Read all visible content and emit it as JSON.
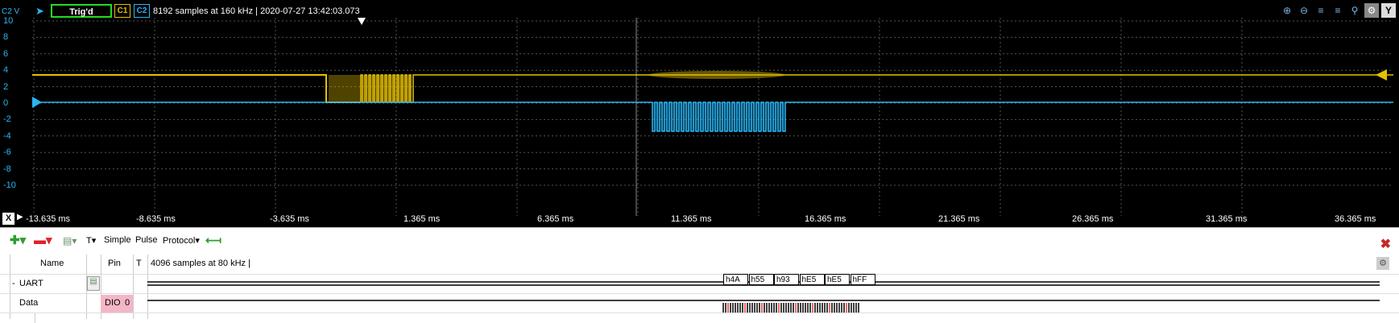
{
  "scope": {
    "channel_label": "C2 V",
    "trigger_status": "Trig'd",
    "c1_label": "C1",
    "c2_label": "C2",
    "info": "8192 samples at 160 kHz | 2020-07-27 13:42:03.073",
    "y_ticks": [
      "10",
      "8",
      "6",
      "4",
      "2",
      "0",
      "-2",
      "-4",
      "-6",
      "-8",
      "-10"
    ],
    "x_axis_button": "X",
    "x_ticks": [
      "-13.635 ms",
      "-8.635 ms",
      "-3.635 ms",
      "1.365 ms",
      "6.365 ms",
      "11.365 ms",
      "16.365 ms",
      "21.365 ms",
      "26.365 ms",
      "31.365 ms",
      "36.365 ms"
    ],
    "colors": {
      "c1": "#e5c100",
      "c2": "#29b6f6",
      "trigger": "#22dd22"
    },
    "tools": [
      "zoom-in-icon",
      "zoom-out-icon",
      "zoom-horizontal-icon",
      "zoom-vertical-icon",
      "magnifier-icon",
      "settings-icon",
      "y-button"
    ],
    "y_button": "Y"
  },
  "logic": {
    "toolbar": {
      "simple": "Simple",
      "pulse": "Pulse",
      "protocol": "Protocol",
      "t_label": "T"
    },
    "columns": {
      "name": "Name",
      "pin": "Pin",
      "t": "T"
    },
    "info": "4096 samples at 80 kHz |",
    "rows": [
      {
        "expander": "-",
        "name": "UART",
        "pin": ""
      },
      {
        "expander": "",
        "name": "Data",
        "pin": "DIO",
        "pin_index": "0"
      }
    ],
    "bytes": [
      "h4A",
      "h55",
      "h93",
      "hE5",
      "hE5",
      "hFF"
    ]
  }
}
